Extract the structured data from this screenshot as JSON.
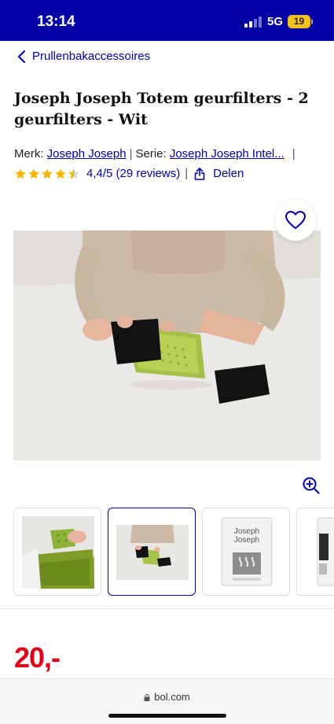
{
  "status_bar": {
    "time": "13:14",
    "network": "5G",
    "battery": "19"
  },
  "breadcrumb": {
    "label": "Prullenbakaccessoires"
  },
  "product": {
    "title": "Joseph Joseph Totem geurfilters - 2 geurfilters - Wit",
    "brand_label": "Merk:",
    "brand": "Joseph Joseph",
    "series_label": "Serie:",
    "series": "Joseph Joseph Intel...",
    "rating_value": 4.4,
    "rating_text": "4,4/5 (29 reviews)",
    "share_label": "Delen",
    "price": "20,-"
  },
  "thumbnails": [
    {
      "name": "thumb-green-bin",
      "active": false
    },
    {
      "name": "thumb-hands-filters",
      "active": true
    },
    {
      "name": "thumb-package",
      "active": false
    },
    {
      "name": "thumb-package-partial",
      "active": false
    }
  ],
  "package_text": {
    "line1": "Joseph",
    "line2": "Joseph"
  },
  "bottom_bar": {
    "url": "bol.com"
  },
  "colors": {
    "brand_blue": "#0000a4",
    "price_red": "#e0001b",
    "star_yellow": "#f7b500",
    "battery": "#f1c21b"
  }
}
